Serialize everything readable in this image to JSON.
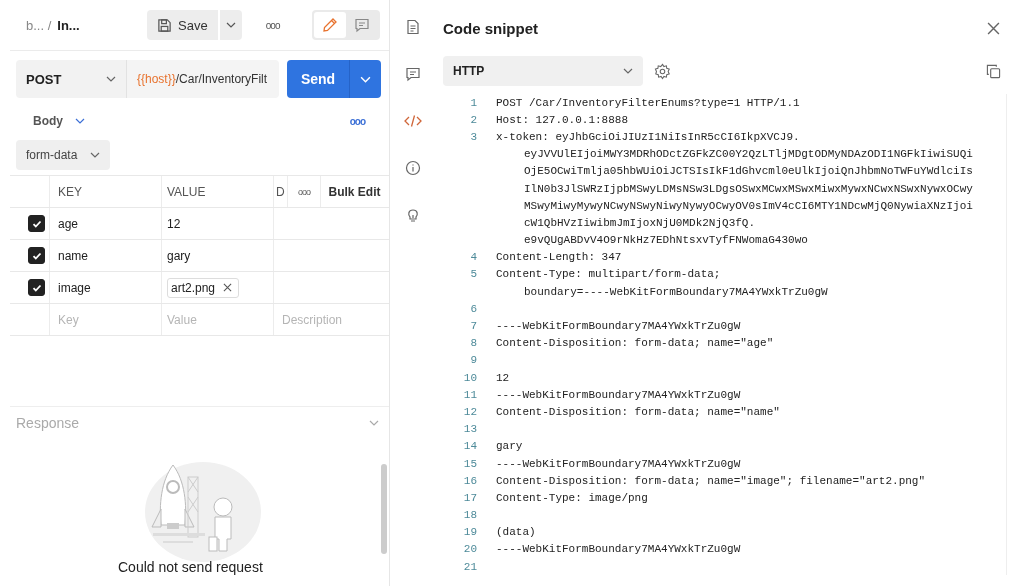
{
  "header": {
    "breadcrumb": [
      {
        "text": "b... /",
        "kind": "parent"
      },
      {
        "text": "In...",
        "kind": "current"
      }
    ],
    "save_label": "Save",
    "more": "ooo",
    "modes": [
      {
        "kind": "edit",
        "selected": true
      },
      {
        "kind": "comment",
        "selected": false
      }
    ]
  },
  "request": {
    "method": "POST",
    "url": [
      {
        "text": "{{host}}",
        "kind": "variable"
      },
      {
        "text": "/Car/InventoryFilt",
        "kind": "path"
      }
    ],
    "send_label": "Send"
  },
  "body_tab": {
    "label": "Body",
    "more": "ooo",
    "mode": "form-data"
  },
  "table": {
    "columns": [
      {
        "label": "KEY"
      },
      {
        "label": "VALUE"
      },
      {
        "label": "D"
      }
    ],
    "more": "ooo",
    "bulk_edit": "Bulk Edit",
    "rows": [
      {
        "checked": true,
        "key": "age",
        "value": "12",
        "kind": "text"
      },
      {
        "checked": true,
        "key": "name",
        "value": "gary",
        "kind": "text"
      },
      {
        "checked": true,
        "key": "image",
        "value": "art2.png",
        "kind": "file"
      }
    ],
    "new_row": [
      {
        "placeholder": "Key"
      },
      {
        "placeholder": "Value"
      },
      {
        "placeholder": "Description"
      }
    ]
  },
  "response": {
    "title": "Response",
    "message": "Could not send request"
  },
  "rail": [
    {
      "kind": "document",
      "selected": false
    },
    {
      "kind": "comment",
      "selected": false
    },
    {
      "kind": "code",
      "selected": true
    },
    {
      "kind": "info",
      "selected": false
    },
    {
      "kind": "bulb",
      "selected": false
    }
  ],
  "snippet": {
    "title": "Code snippet",
    "language": "HTTP",
    "lines": [
      {
        "number": "1",
        "text": "POST /Car/InventoryFilterEnums?type=1 HTTP/1.1"
      },
      {
        "number": "2",
        "text": "Host: 127.0.0.1:8888"
      },
      {
        "number": "3",
        "text": "x-token: eyJhbGciOiJIUzI1NiIsInR5cCI6IkpXVCJ9.",
        "wrapped": [
          "eyJVVUlEIjoiMWY3MDRhODctZGFkZC00Y2QzLTljMDgtODMyNDAzODI1NGFkIiwiSUQi",
          "OjE5OCwiTmlja05hbWUiOiJCTSIsIkF1dGhvcml0eUlkIjoiQnJhbmNoTWFuYWdlciIs",
          "IlN0b3JlSWRzIjpbMSwyLDMsNSw3LDgsOSwxMCwxMSwxMiwxMywxNCwxNSwxNywxOCwy",
          "MSwyMiwyMywyNCwyNSwyNiwyNywyOCwyOV0sImV4cCI6MTY1NDcwMjQ0NywiaXNzIjoi",
          "cW1QbHVzIiwibmJmIjoxNjU0MDk2NjQ3fQ.",
          "e9vQUgABDvV4O9rNkHz7EDhNtsxvTyfFNWomaG430wo"
        ]
      },
      {
        "number": "4",
        "text": "Content-Length: 347"
      },
      {
        "number": "5",
        "text": "Content-Type: multipart/form-data;",
        "wrapped": [
          "boundary=----WebKitFormBoundary7MA4YWxkTrZu0gW"
        ]
      },
      {
        "number": "6"
      },
      {
        "number": "7",
        "text": "----WebKitFormBoundary7MA4YWxkTrZu0gW"
      },
      {
        "number": "8",
        "text": "Content-Disposition: form-data; name=\"age\""
      },
      {
        "number": "9"
      },
      {
        "number": "10",
        "text": "12"
      },
      {
        "number": "11",
        "text": "----WebKitFormBoundary7MA4YWxkTrZu0gW"
      },
      {
        "number": "12",
        "text": "Content-Disposition: form-data; name=\"name\""
      },
      {
        "number": "13"
      },
      {
        "number": "14",
        "text": "gary"
      },
      {
        "number": "15",
        "text": "----WebKitFormBoundary7MA4YWxkTrZu0gW"
      },
      {
        "number": "16",
        "text": "Content-Disposition: form-data; name=\"image\"; filename=\"art2.png\""
      },
      {
        "number": "17",
        "text": "Content-Type: image/png"
      },
      {
        "number": "18"
      },
      {
        "number": "19",
        "text": "(data)"
      },
      {
        "number": "20",
        "text": "----WebKitFormBoundary7MA4YWxkTrZu0gW"
      },
      {
        "number": "21"
      }
    ]
  }
}
